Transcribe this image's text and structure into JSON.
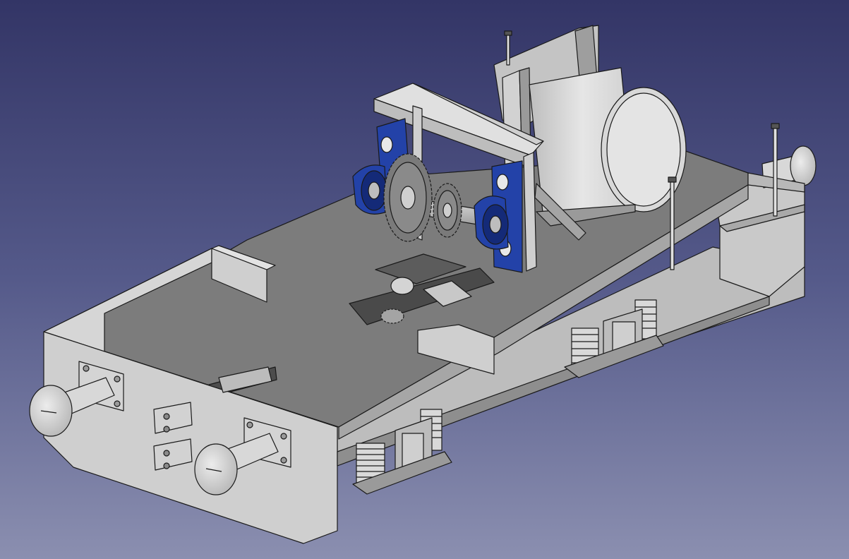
{
  "view": {
    "background_top": "#333566",
    "background_bottom": "#8b8fb0"
  },
  "colors": {
    "part_gray": "#c8c8c8",
    "part_light": "#dedede",
    "part_dark": "#8e8e8e",
    "deck": "#7a7a7a",
    "bearing_blue": "#2342a8",
    "bearing_blue_dark": "#142a78",
    "outline": "#1a1a1a"
  },
  "model": {
    "name": "locomotive-chassis-assembly",
    "parts": [
      "chassis-frame",
      "front-buffer-beam",
      "buffer-left",
      "buffer-right",
      "coupling-hook",
      "rear-buffer",
      "motor-drum",
      "bearing-frame",
      "bearing-left",
      "bearing-right",
      "sprocket-large",
      "sprocket-small",
      "drive-shaft",
      "suspension-spring-front",
      "suspension-spring-rear",
      "axle-box-front",
      "axle-box-rear",
      "antenna-rod"
    ]
  }
}
